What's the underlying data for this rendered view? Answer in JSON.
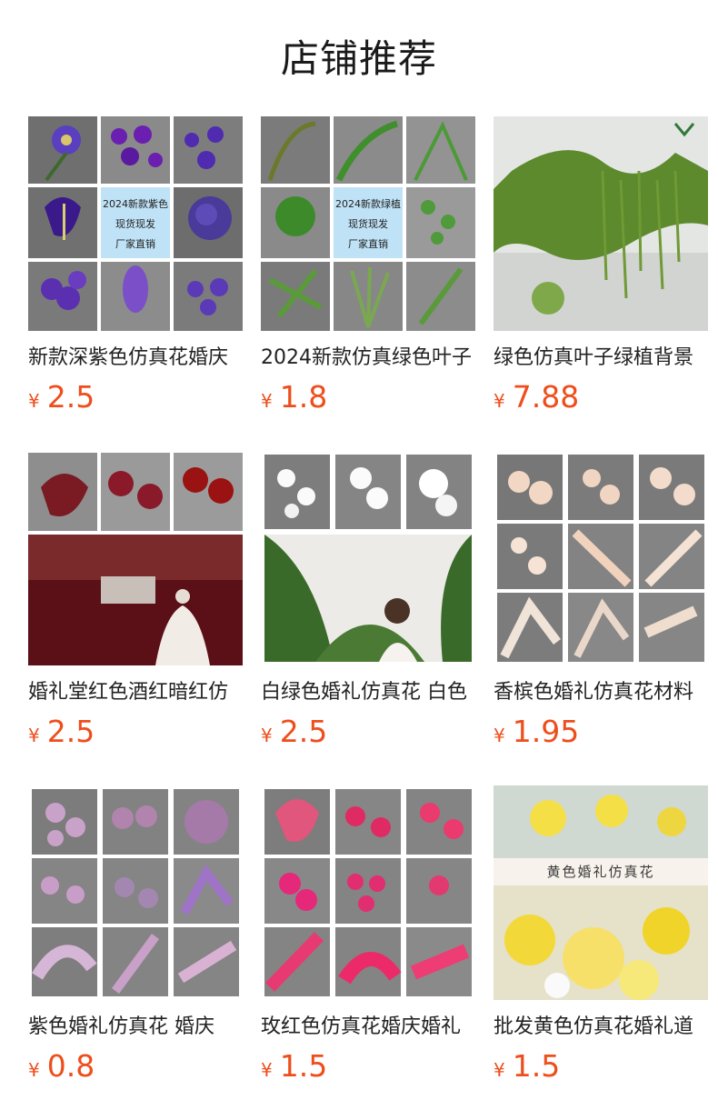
{
  "header": {
    "title": "店铺推荐"
  },
  "currency_symbol": "¥",
  "products": [
    {
      "name": "新款深紫色仿真花婚庆",
      "price": "2.5",
      "overlay": [
        "2024新款紫色",
        "现货现发",
        "厂家直销"
      ]
    },
    {
      "name": "2024新款仿真绿色叶子",
      "price": "1.8",
      "overlay": [
        "2024新款绿植",
        "现货现发",
        "厂家直销"
      ]
    },
    {
      "name": "绿色仿真叶子绿植背景",
      "price": "7.88"
    },
    {
      "name": "婚礼堂红色酒红暗红仿",
      "price": "2.5"
    },
    {
      "name": "白绿色婚礼仿真花 白色",
      "price": "2.5"
    },
    {
      "name": "香槟色婚礼仿真花材料",
      "price": "1.95"
    },
    {
      "name": "紫色婚礼仿真花 婚庆",
      "price": "0.8"
    },
    {
      "name": "玫红色仿真花婚庆婚礼",
      "price": "1.5"
    },
    {
      "name": "批发黄色仿真花婚礼道",
      "price": "1.5",
      "banner": "黄色婚礼仿真花"
    }
  ]
}
